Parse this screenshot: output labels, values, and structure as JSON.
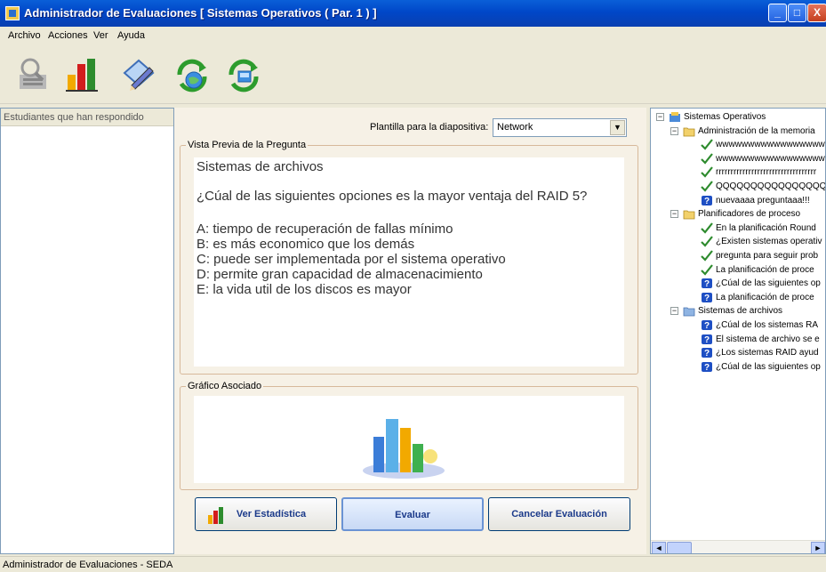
{
  "window": {
    "title": "Administrador de Evaluaciones [ Sistemas Operativos ( Par. 1 ) ]",
    "min_glyph": "_",
    "max_glyph": "□",
    "close_glyph": "X"
  },
  "menu": [
    "Archivo",
    "Acciones",
    "Ver",
    "Ayuda"
  ],
  "toolbar": {
    "icons": [
      "search-users-icon",
      "statistics-icon",
      "edit-pen-icon",
      "refresh-globe-icon",
      "refresh-sync-icon"
    ]
  },
  "left_panel": {
    "header": "Estudiantes que han respondido"
  },
  "template": {
    "label": "Plantilla para la diapositiva:",
    "selected": "Network",
    "arrow_glyph": "▼"
  },
  "preview": {
    "legend": "Vista Previa de la Pregunta",
    "topic": "Sistemas de archivos",
    "question": "¿Cúal de las siguientes opciones es la mayor ventaja del RAID 5?",
    "options": [
      "A: tiempo de recuperación de fallas mínimo",
      "B: es más economico que los demás",
      "C: puede ser implementada por el sistema operativo",
      "D: permite gran capacidad de almacenacimiento",
      "E: la vida util de los discos es mayor"
    ]
  },
  "chart_group": {
    "legend": "Gráfico Asociado"
  },
  "buttons": {
    "stats": "Ver Estadística",
    "evaluate": "Evaluar",
    "cancel": "Cancelar Evaluación"
  },
  "tree": {
    "root": "Sistemas Operativos",
    "folders": [
      {
        "label": "Administración de la memoria",
        "items": [
          {
            "label": "wwwwwwwwwwwwwwwwwwwwwww",
            "status": "check"
          },
          {
            "label": "wwwwwwwwwwwwwwwwwwwwwww",
            "status": "check"
          },
          {
            "label": "rrrrrrrrrrrrrrrrrrrrrrrrrrrrrrrrrr",
            "status": "check"
          },
          {
            "label": "QQQQQQQQQQQQQQQQ",
            "status": "check"
          },
          {
            "label": "nuevaaaa preguntaaa!!!",
            "status": "question"
          }
        ]
      },
      {
        "label": "Planificadores de proceso",
        "items": [
          {
            "label": "En la planificación Round",
            "status": "check"
          },
          {
            "label": "¿Existen sistemas operativ",
            "status": "check"
          },
          {
            "label": "pregunta para seguir prob",
            "status": "check"
          },
          {
            "label": "La planificación de proce",
            "status": "check"
          },
          {
            "label": "¿Cúal de las siguientes op",
            "status": "question"
          },
          {
            "label": "La planificación de proce",
            "status": "question"
          }
        ]
      },
      {
        "label": "Sistemas de archivos",
        "items": [
          {
            "label": "¿Cúal de los sistemas RA",
            "status": "question"
          },
          {
            "label": "El sistema de archivo se e",
            "status": "question"
          },
          {
            "label": "¿Los sistemas RAID ayud",
            "status": "question"
          },
          {
            "label": "¿Cúal de las siguientes op",
            "status": "question"
          }
        ]
      }
    ],
    "expander_glyph": "−",
    "scroll_left": "◄",
    "scroll_right": "►"
  },
  "status_bar": "Administrador de Evaluaciones - SEDA",
  "colors": {
    "title_bar": "#0047c8",
    "window_bg": "#ece9d8",
    "panel_bg": "#f6f1e6",
    "check": "#2e8b2e",
    "question": "#1e4fc4"
  }
}
